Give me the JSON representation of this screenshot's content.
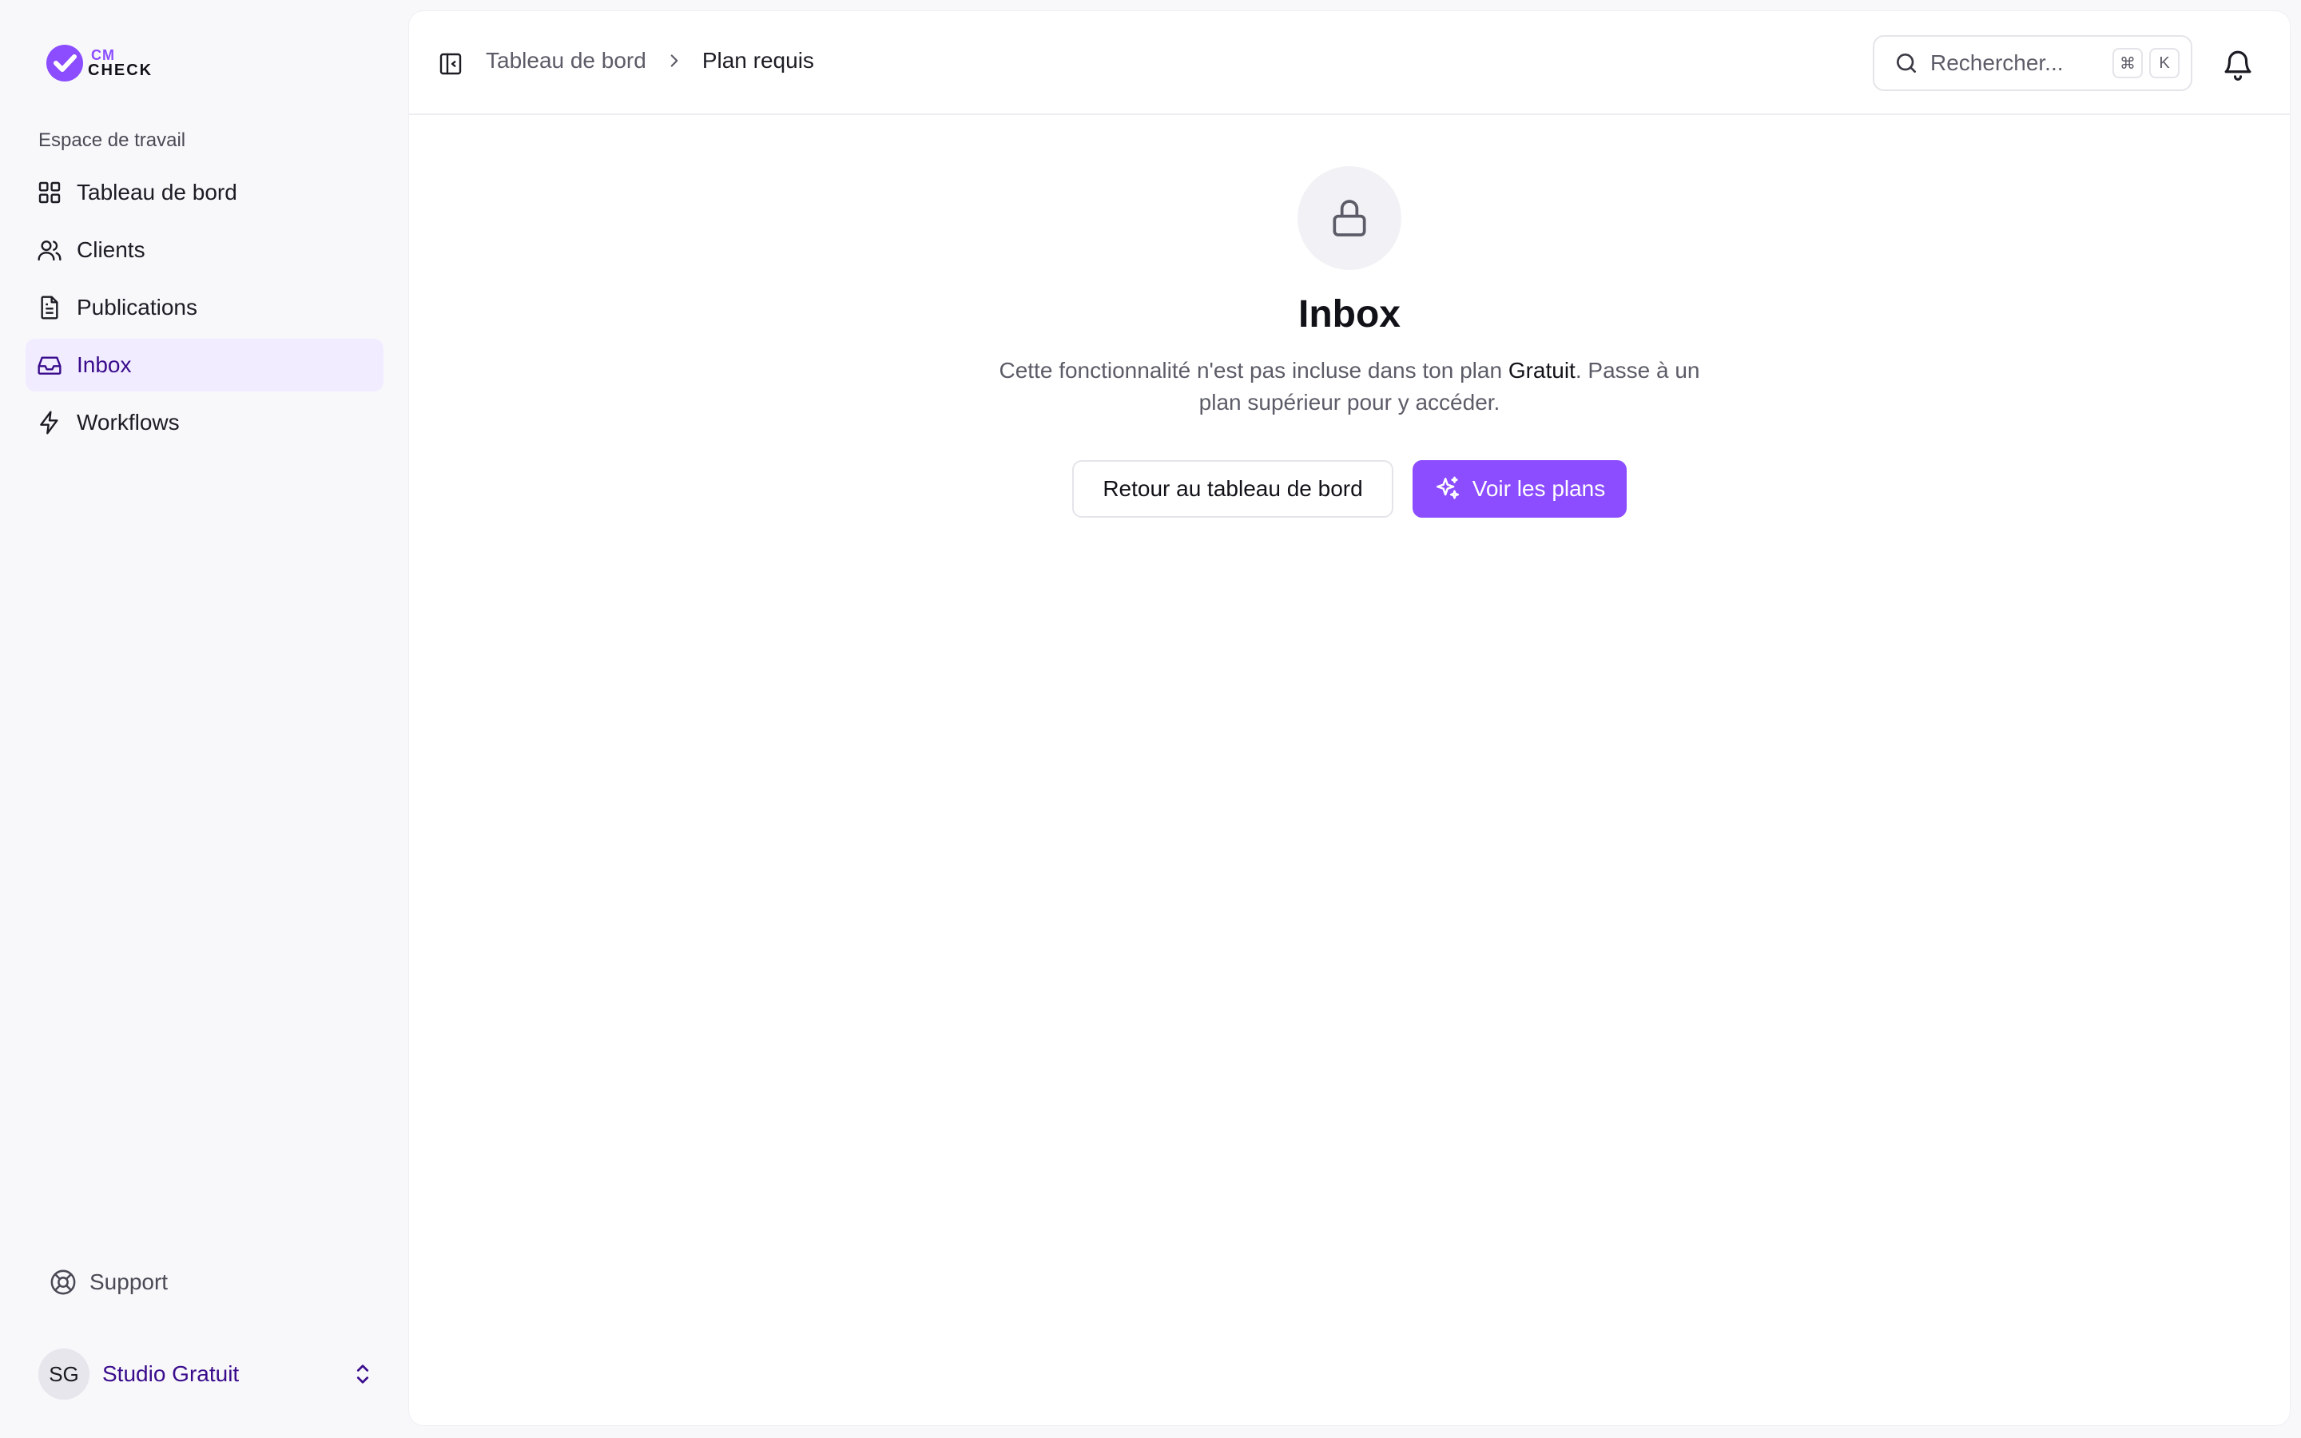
{
  "brand": {
    "line1": "CM",
    "line2": "CHECK",
    "accent": "#8b4dff"
  },
  "sidebar": {
    "section_label": "Espace de travail",
    "items": [
      {
        "label": "Tableau de bord",
        "icon": "dashboard-grid-icon"
      },
      {
        "label": "Clients",
        "icon": "users-icon"
      },
      {
        "label": "Publications",
        "icon": "document-icon"
      },
      {
        "label": "Inbox",
        "icon": "inbox-icon",
        "active": true
      },
      {
        "label": "Workflows",
        "icon": "lightning-icon"
      }
    ],
    "support_label": "Support",
    "user": {
      "initials": "SG",
      "name": "Studio Gratuit"
    }
  },
  "topbar": {
    "breadcrumb": {
      "parent": "Tableau de bord",
      "current": "Plan requis"
    },
    "search": {
      "placeholder": "Rechercher...",
      "shortcut_mod": "⌘",
      "shortcut_key": "K"
    }
  },
  "locked": {
    "title": "Inbox",
    "desc_before": "Cette fonctionnalité n'est pas incluse dans ton plan ",
    "plan_name": "Gratuit",
    "desc_after": ". Passe à un plan supérieur pour y accéder.",
    "back_button": "Retour au tableau de bord",
    "plans_button": "Voir les plans"
  }
}
